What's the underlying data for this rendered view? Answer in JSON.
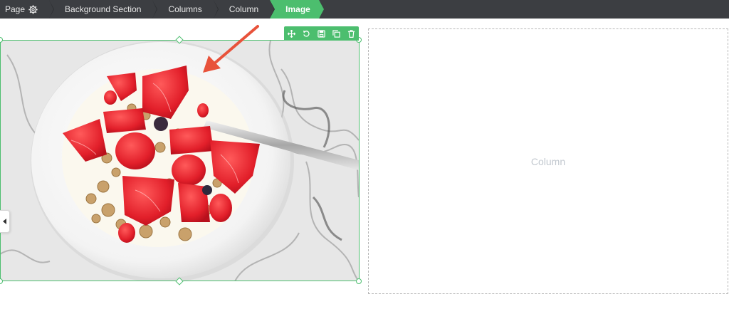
{
  "breadcrumb": {
    "items": [
      {
        "label": "Page"
      },
      {
        "label": "Background Section"
      },
      {
        "label": "Columns"
      },
      {
        "label": "Column"
      },
      {
        "label": "Image"
      }
    ],
    "active_index": 4
  },
  "toolbar": {
    "actions": [
      "move-icon",
      "undo-icon",
      "save-icon",
      "duplicate-icon",
      "delete-icon"
    ]
  },
  "empty_column": {
    "label": "Column"
  },
  "colors": {
    "accent": "#4cbe6e",
    "topbar": "#3c3e42",
    "arrow": "#e8523a"
  }
}
